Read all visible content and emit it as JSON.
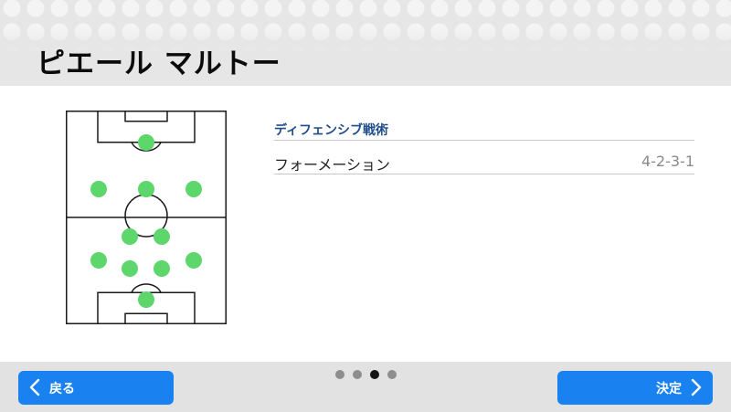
{
  "header": {
    "title": "ピエール マルトー"
  },
  "tactics": {
    "section_title": "ディフェンシブ戦術",
    "formation_label": "フォーメーション",
    "formation_value": "4-2-3-1"
  },
  "pitch": {
    "player_color": "#5dd66c",
    "player_count": 11
  },
  "pagination": {
    "count": 4,
    "active_index": 2
  },
  "footer": {
    "back_label": "戻る",
    "confirm_label": "決定",
    "button_color": "#1a82f0"
  }
}
